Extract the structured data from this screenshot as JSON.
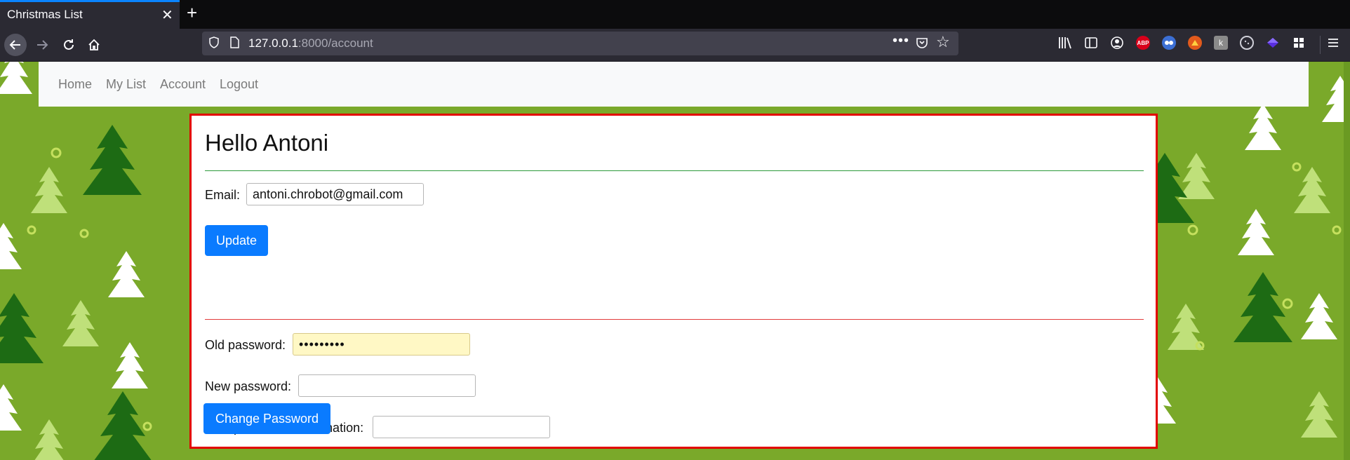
{
  "browser": {
    "tab_title": "Christmas List",
    "url_host": "127.0.0.1",
    "url_rest": ":8000/account",
    "extensions": [
      "library-icon",
      "sidebar-icon",
      "account-icon",
      "adblock-plus-icon",
      "privacy-badger-icon",
      "firefox-relay-icon",
      "k-extension-icon",
      "cookie-icon",
      "diamond-extension-icon",
      "extensions-grid-icon"
    ]
  },
  "site_nav": {
    "home": "Home",
    "my_list": "My List",
    "account": "Account",
    "logout": "Logout"
  },
  "account": {
    "greeting": "Hello Antoni",
    "email_label": "Email:",
    "email_value": "antoni.chrobot@gmail.com",
    "update_label": "Update",
    "old_password_label": "Old password:",
    "old_password_value": "•••••••••",
    "new_password_label": "New password:",
    "new_password_value": "",
    "confirm_label": "New password confirmation:",
    "confirm_value": "",
    "change_password_label": "Change Password"
  },
  "colors": {
    "background_green": "#7aa92a",
    "card_border": "#e20000",
    "button_blue": "#0a7bff",
    "rule_green": "#2c9a3b",
    "rule_red": "#e23b3b"
  }
}
